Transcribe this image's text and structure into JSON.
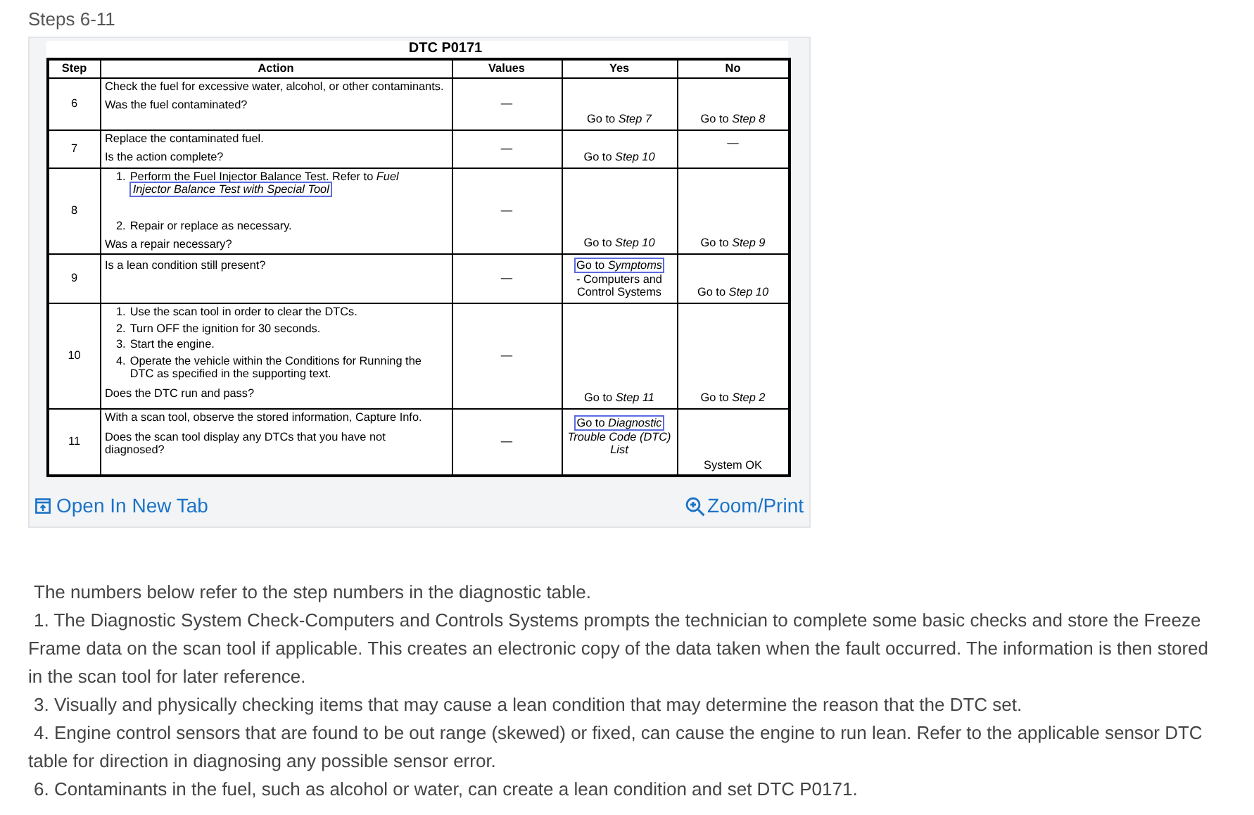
{
  "heading": "Steps 6-11",
  "table": {
    "title": "DTC P0171",
    "columns": [
      "Step",
      "Action",
      "Values",
      "Yes",
      "No"
    ],
    "rows": [
      {
        "step": "6",
        "action": [
          {
            "kind": "text",
            "text": "Check the fuel for excessive water, alcohol, or other contaminants."
          },
          {
            "kind": "question",
            "text": "Was the fuel contaminated?"
          }
        ],
        "values": "—",
        "yes": {
          "text": "Go to *Step 7*"
        },
        "no": {
          "text": "Go to *Step 8*"
        }
      },
      {
        "step": "7",
        "action": [
          {
            "kind": "text",
            "text": "Replace the contaminated fuel."
          },
          {
            "kind": "question",
            "text": "Is the action complete?"
          }
        ],
        "values": "—",
        "yes": {
          "text": "Go to *Step 10*"
        },
        "no": {
          "text": "—",
          "at_top": true
        }
      },
      {
        "step": "8",
        "action": [
          {
            "kind": "numbered",
            "number": "1.",
            "text": "Perform the Fuel Injector Balance Test. Refer to *Fuel*",
            "link": "*Injector Balance Test with Special Tool*"
          },
          {
            "kind": "numbered",
            "number": "2.",
            "text": "Repair or replace as necessary."
          },
          {
            "kind": "question",
            "text": "Was a repair necessary?"
          }
        ],
        "values": "—",
        "yes": {
          "text": "Go to *Step 10*"
        },
        "no": {
          "text": "Go to *Step 9*"
        }
      },
      {
        "step": "9",
        "action": [
          {
            "kind": "question",
            "text": "Is a lean condition still present?"
          }
        ],
        "values": "—",
        "yes": {
          "link": "Go to *Symptoms*",
          "text": "- Computers and Control Systems"
        },
        "no": {
          "text": "Go to *Step 10*"
        }
      },
      {
        "step": "10",
        "action": [
          {
            "kind": "numbered",
            "number": "1.",
            "text": "Use the scan tool in order to clear the DTCs."
          },
          {
            "kind": "numbered",
            "number": "2.",
            "text": "Turn OFF the ignition for 30 seconds."
          },
          {
            "kind": "numbered",
            "number": "3.",
            "text": "Start the engine."
          },
          {
            "kind": "numbered",
            "number": "4.",
            "text": "Operate the vehicle within the Conditions for Running the DTC as specified in the supporting text."
          },
          {
            "kind": "question",
            "text": "Does the DTC run and pass?"
          }
        ],
        "values": "—",
        "yes": {
          "text": "Go to *Step 11*"
        },
        "no": {
          "text": "Go to *Step 2*"
        }
      },
      {
        "step": "11",
        "action": [
          {
            "kind": "text",
            "text": "With a scan tool, observe the stored information, Capture Info."
          },
          {
            "kind": "question",
            "text": "Does the scan tool display any DTCs that you have not diagnosed?"
          }
        ],
        "values": "—",
        "yes": {
          "link": "Go to *Diagnostic*",
          "text": "*Trouble Code (DTC) List*",
          "at_top": true
        },
        "no": {
          "text": "System OK"
        }
      }
    ]
  },
  "open_link": "Open In New Tab",
  "zoom_link": "Zoom/Print",
  "paragraphs": [
    "The numbers below refer to the step numbers in the diagnostic table.",
    "1. The Diagnostic System Check-Computers and Controls Systems prompts the technician to complete some basic checks and store the Freeze Frame data on the scan tool if applicable. This creates an electronic copy of the data taken when the fault occurred. The information is then stored in the scan tool for later reference.",
    "3. Visually and physically checking items that may cause a lean condition that may determine the reason that the DTC set.",
    "4. Engine control sensors that are found to be out range (skewed) or fixed, can cause the engine to run lean. Refer to the applicable sensor DTC table for direction in diagnosing any possible sensor error.",
    "6. Contaminants in the fuel, such as alcohol or water, can create a lean condition and set DTC P0171."
  ]
}
